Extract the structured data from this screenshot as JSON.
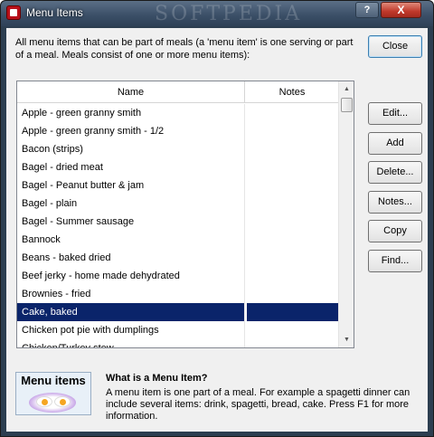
{
  "window": {
    "title": "Menu Items",
    "watermark": "SOFTPEDIA",
    "help_label": "?",
    "close_label": "X"
  },
  "description": "All menu items that can be part of meals (a 'menu item' is one serving or part of a meal. Meals consist of one or more menu items):",
  "buttons": {
    "close": "Close",
    "edit": "Edit...",
    "add": "Add",
    "delete": "Delete...",
    "notes": "Notes...",
    "copy": "Copy",
    "find": "Find..."
  },
  "list": {
    "columns": [
      "Name",
      "Notes"
    ],
    "rows": [
      {
        "name": "Apple - green granny smith",
        "notes": ""
      },
      {
        "name": "Apple - green granny smith - 1/2",
        "notes": ""
      },
      {
        "name": "Bacon (strips)",
        "notes": ""
      },
      {
        "name": "Bagel - dried meat",
        "notes": ""
      },
      {
        "name": "Bagel - Peanut butter & jam",
        "notes": ""
      },
      {
        "name": "Bagel - plain",
        "notes": ""
      },
      {
        "name": "Bagel - Summer sausage",
        "notes": ""
      },
      {
        "name": "Bannock",
        "notes": ""
      },
      {
        "name": "Beans - baked dried",
        "notes": ""
      },
      {
        "name": "Beef jerky - home made dehydrated",
        "notes": ""
      },
      {
        "name": "Brownies - fried",
        "notes": ""
      },
      {
        "name": "Cake, baked",
        "notes": "",
        "selected": true
      },
      {
        "name": "Chicken pot pie with dumplings",
        "notes": ""
      },
      {
        "name": "Chicken/Turkey stew",
        "notes": ""
      }
    ],
    "selection_color": "#0a246a"
  },
  "info": {
    "icon_title": "Menu items",
    "icon_name": "fried-eggs-plate-icon",
    "heading": "What is a Menu Item?",
    "text": "A menu item is one part of a meal. For example a spagetti dinner can include several items: drink, spagetti, bread, cake. Press F1 for more information."
  },
  "colors": {
    "titlebar": "#3a4e66",
    "close_button": "#c0392b",
    "dialog_bg": "#f0f0f0"
  }
}
